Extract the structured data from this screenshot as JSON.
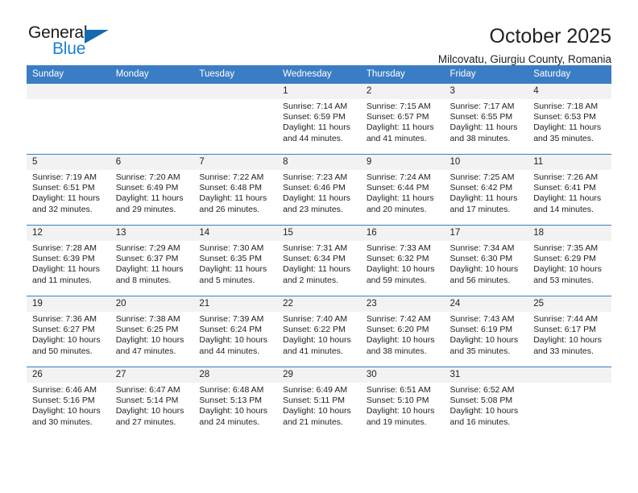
{
  "brand": {
    "name_top": "General",
    "name_bottom": "Blue",
    "triangle_color": "#1469b0",
    "blue_color": "#1b7fd4"
  },
  "header": {
    "title": "October 2025",
    "subtitle": "Milcovatu, Giurgiu County, Romania"
  },
  "theme": {
    "header_row_bg": "#3b7dc4",
    "daynum_bg": "#f2f2f2",
    "grid_line": "#3b7dc4",
    "text": "#222222"
  },
  "weekday_headers": [
    "Sunday",
    "Monday",
    "Tuesday",
    "Wednesday",
    "Thursday",
    "Friday",
    "Saturday"
  ],
  "labels": {
    "sunrise": "Sunrise:",
    "sunset": "Sunset:",
    "daylight": "Daylight:"
  },
  "weeks": [
    [
      {
        "day": "",
        "empty": true,
        "sunrise": "",
        "sunset": "",
        "daylight_line1": "",
        "daylight_line2": ""
      },
      {
        "day": "",
        "empty": true,
        "sunrise": "",
        "sunset": "",
        "daylight_line1": "",
        "daylight_line2": ""
      },
      {
        "day": "",
        "empty": true,
        "sunrise": "",
        "sunset": "",
        "daylight_line1": "",
        "daylight_line2": ""
      },
      {
        "day": "1",
        "empty": false,
        "sunrise": "Sunrise: 7:14 AM",
        "sunset": "Sunset: 6:59 PM",
        "daylight_line1": "Daylight: 11 hours",
        "daylight_line2": "and 44 minutes."
      },
      {
        "day": "2",
        "empty": false,
        "sunrise": "Sunrise: 7:15 AM",
        "sunset": "Sunset: 6:57 PM",
        "daylight_line1": "Daylight: 11 hours",
        "daylight_line2": "and 41 minutes."
      },
      {
        "day": "3",
        "empty": false,
        "sunrise": "Sunrise: 7:17 AM",
        "sunset": "Sunset: 6:55 PM",
        "daylight_line1": "Daylight: 11 hours",
        "daylight_line2": "and 38 minutes."
      },
      {
        "day": "4",
        "empty": false,
        "sunrise": "Sunrise: 7:18 AM",
        "sunset": "Sunset: 6:53 PM",
        "daylight_line1": "Daylight: 11 hours",
        "daylight_line2": "and 35 minutes."
      }
    ],
    [
      {
        "day": "5",
        "empty": false,
        "sunrise": "Sunrise: 7:19 AM",
        "sunset": "Sunset: 6:51 PM",
        "daylight_line1": "Daylight: 11 hours",
        "daylight_line2": "and 32 minutes."
      },
      {
        "day": "6",
        "empty": false,
        "sunrise": "Sunrise: 7:20 AM",
        "sunset": "Sunset: 6:49 PM",
        "daylight_line1": "Daylight: 11 hours",
        "daylight_line2": "and 29 minutes."
      },
      {
        "day": "7",
        "empty": false,
        "sunrise": "Sunrise: 7:22 AM",
        "sunset": "Sunset: 6:48 PM",
        "daylight_line1": "Daylight: 11 hours",
        "daylight_line2": "and 26 minutes."
      },
      {
        "day": "8",
        "empty": false,
        "sunrise": "Sunrise: 7:23 AM",
        "sunset": "Sunset: 6:46 PM",
        "daylight_line1": "Daylight: 11 hours",
        "daylight_line2": "and 23 minutes."
      },
      {
        "day": "9",
        "empty": false,
        "sunrise": "Sunrise: 7:24 AM",
        "sunset": "Sunset: 6:44 PM",
        "daylight_line1": "Daylight: 11 hours",
        "daylight_line2": "and 20 minutes."
      },
      {
        "day": "10",
        "empty": false,
        "sunrise": "Sunrise: 7:25 AM",
        "sunset": "Sunset: 6:42 PM",
        "daylight_line1": "Daylight: 11 hours",
        "daylight_line2": "and 17 minutes."
      },
      {
        "day": "11",
        "empty": false,
        "sunrise": "Sunrise: 7:26 AM",
        "sunset": "Sunset: 6:41 PM",
        "daylight_line1": "Daylight: 11 hours",
        "daylight_line2": "and 14 minutes."
      }
    ],
    [
      {
        "day": "12",
        "empty": false,
        "sunrise": "Sunrise: 7:28 AM",
        "sunset": "Sunset: 6:39 PM",
        "daylight_line1": "Daylight: 11 hours",
        "daylight_line2": "and 11 minutes."
      },
      {
        "day": "13",
        "empty": false,
        "sunrise": "Sunrise: 7:29 AM",
        "sunset": "Sunset: 6:37 PM",
        "daylight_line1": "Daylight: 11 hours",
        "daylight_line2": "and 8 minutes."
      },
      {
        "day": "14",
        "empty": false,
        "sunrise": "Sunrise: 7:30 AM",
        "sunset": "Sunset: 6:35 PM",
        "daylight_line1": "Daylight: 11 hours",
        "daylight_line2": "and 5 minutes."
      },
      {
        "day": "15",
        "empty": false,
        "sunrise": "Sunrise: 7:31 AM",
        "sunset": "Sunset: 6:34 PM",
        "daylight_line1": "Daylight: 11 hours",
        "daylight_line2": "and 2 minutes."
      },
      {
        "day": "16",
        "empty": false,
        "sunrise": "Sunrise: 7:33 AM",
        "sunset": "Sunset: 6:32 PM",
        "daylight_line1": "Daylight: 10 hours",
        "daylight_line2": "and 59 minutes."
      },
      {
        "day": "17",
        "empty": false,
        "sunrise": "Sunrise: 7:34 AM",
        "sunset": "Sunset: 6:30 PM",
        "daylight_line1": "Daylight: 10 hours",
        "daylight_line2": "and 56 minutes."
      },
      {
        "day": "18",
        "empty": false,
        "sunrise": "Sunrise: 7:35 AM",
        "sunset": "Sunset: 6:29 PM",
        "daylight_line1": "Daylight: 10 hours",
        "daylight_line2": "and 53 minutes."
      }
    ],
    [
      {
        "day": "19",
        "empty": false,
        "sunrise": "Sunrise: 7:36 AM",
        "sunset": "Sunset: 6:27 PM",
        "daylight_line1": "Daylight: 10 hours",
        "daylight_line2": "and 50 minutes."
      },
      {
        "day": "20",
        "empty": false,
        "sunrise": "Sunrise: 7:38 AM",
        "sunset": "Sunset: 6:25 PM",
        "daylight_line1": "Daylight: 10 hours",
        "daylight_line2": "and 47 minutes."
      },
      {
        "day": "21",
        "empty": false,
        "sunrise": "Sunrise: 7:39 AM",
        "sunset": "Sunset: 6:24 PM",
        "daylight_line1": "Daylight: 10 hours",
        "daylight_line2": "and 44 minutes."
      },
      {
        "day": "22",
        "empty": false,
        "sunrise": "Sunrise: 7:40 AM",
        "sunset": "Sunset: 6:22 PM",
        "daylight_line1": "Daylight: 10 hours",
        "daylight_line2": "and 41 minutes."
      },
      {
        "day": "23",
        "empty": false,
        "sunrise": "Sunrise: 7:42 AM",
        "sunset": "Sunset: 6:20 PM",
        "daylight_line1": "Daylight: 10 hours",
        "daylight_line2": "and 38 minutes."
      },
      {
        "day": "24",
        "empty": false,
        "sunrise": "Sunrise: 7:43 AM",
        "sunset": "Sunset: 6:19 PM",
        "daylight_line1": "Daylight: 10 hours",
        "daylight_line2": "and 35 minutes."
      },
      {
        "day": "25",
        "empty": false,
        "sunrise": "Sunrise: 7:44 AM",
        "sunset": "Sunset: 6:17 PM",
        "daylight_line1": "Daylight: 10 hours",
        "daylight_line2": "and 33 minutes."
      }
    ],
    [
      {
        "day": "26",
        "empty": false,
        "sunrise": "Sunrise: 6:46 AM",
        "sunset": "Sunset: 5:16 PM",
        "daylight_line1": "Daylight: 10 hours",
        "daylight_line2": "and 30 minutes."
      },
      {
        "day": "27",
        "empty": false,
        "sunrise": "Sunrise: 6:47 AM",
        "sunset": "Sunset: 5:14 PM",
        "daylight_line1": "Daylight: 10 hours",
        "daylight_line2": "and 27 minutes."
      },
      {
        "day": "28",
        "empty": false,
        "sunrise": "Sunrise: 6:48 AM",
        "sunset": "Sunset: 5:13 PM",
        "daylight_line1": "Daylight: 10 hours",
        "daylight_line2": "and 24 minutes."
      },
      {
        "day": "29",
        "empty": false,
        "sunrise": "Sunrise: 6:49 AM",
        "sunset": "Sunset: 5:11 PM",
        "daylight_line1": "Daylight: 10 hours",
        "daylight_line2": "and 21 minutes."
      },
      {
        "day": "30",
        "empty": false,
        "sunrise": "Sunrise: 6:51 AM",
        "sunset": "Sunset: 5:10 PM",
        "daylight_line1": "Daylight: 10 hours",
        "daylight_line2": "and 19 minutes."
      },
      {
        "day": "31",
        "empty": false,
        "sunrise": "Sunrise: 6:52 AM",
        "sunset": "Sunset: 5:08 PM",
        "daylight_line1": "Daylight: 10 hours",
        "daylight_line2": "and 16 minutes."
      },
      {
        "day": "",
        "empty": true,
        "sunrise": "",
        "sunset": "",
        "daylight_line1": "",
        "daylight_line2": ""
      }
    ]
  ]
}
